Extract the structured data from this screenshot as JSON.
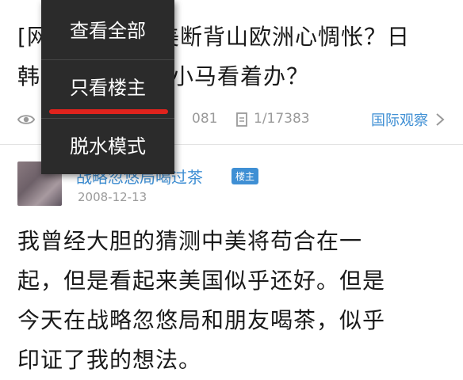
{
  "post": {
    "title_line1": "[网",
    "title_line1_rest": "美断背山欧洲心惆怅？日",
    "title_line2": "韩",
    "title_line2_rest": "小马看着办？",
    "views": "081",
    "pages": "1/17383",
    "category": "国际观察"
  },
  "author": {
    "name": "战略忽悠局喝过茶",
    "badge": "楼主",
    "date": "2008-12-13"
  },
  "content": {
    "line1": "我曾经大胆的猜测中美将苟合在一",
    "line2": "起，但是看起来美国似乎还好。但是",
    "line3": "今天在战略忽悠局和朋友喝茶，似乎",
    "line4": "印证了我的想法。"
  },
  "menu": {
    "items": [
      {
        "label": "查看全部"
      },
      {
        "label": "只看楼主"
      },
      {
        "label": "脱水模式"
      }
    ]
  },
  "colors": {
    "accent": "#3f8fd4",
    "menu_bg": "#2b2b2b",
    "highlight": "#e0231d"
  }
}
